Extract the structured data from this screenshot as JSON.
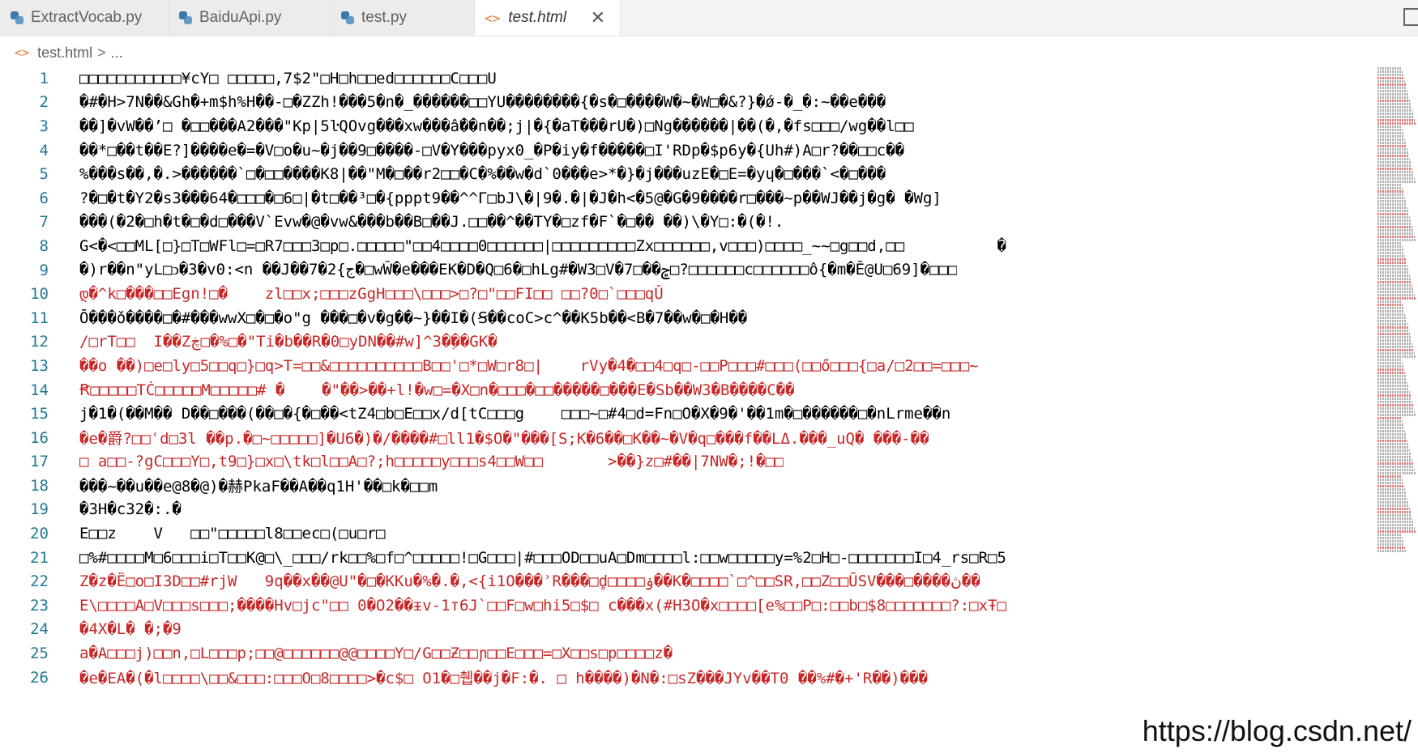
{
  "tabs": [
    {
      "label": "ExtractVocab.py",
      "icon": "python-file-icon"
    },
    {
      "label": "BaiduApi.py",
      "icon": "python-file-icon"
    },
    {
      "label": "test.py",
      "icon": "python-file-icon"
    },
    {
      "label": "test.html",
      "icon": "html-file-icon",
      "active": true,
      "close": "✕"
    }
  ],
  "breadcrumb": {
    "file": "test.html",
    "sep": ">",
    "rest": "..."
  },
  "editor": {
    "lines": [
      {
        "n": "1",
        "text": "□□□□□□□□□□□¥cY□ □□□□□,7$2\"□H□h□□ed□□□□□□C□□□U",
        "red": false
      },
      {
        "n": "2",
        "text": "�#�H>7N��&Gh�+m$h%H��-□�ZZh!���5�n�_������□□YU��������{�s�□����W�~�W□�&?}�ǿ-�_�:~��e���",
        "red": false
      },
      {
        "n": "3",
        "text": "��]�vW��’□ �□□���A2���\"Kp|5ŀQOvg���xw���ấ��n��;j|�{�aT���rU�)□Ng������|��(�,�fs□□□/wg��l□□",
        "red": false
      },
      {
        "n": "4",
        "text": "��*□��t��E?]����e�=�V□o�u~�j��9□����-□V�Y���pyx0_�P�iy�f�����□I'RDp�$p6y�{Uh#)A□r?��□□c��",
        "red": false
      },
      {
        "n": "5",
        "text": "%���s��,�.>������`□�□□����K8|��\"M�□��r2□□�C�%��w�d`0���e>*�}�j���uzE�□E=�yɥ�□���`<�□���",
        "red": false
      },
      {
        "n": "6",
        "text": "?�□�t�Y2�s3���64�□□□�□6□|�t□��³□�{pppt9��^^Γ□bJ\\�|9�.�|�J�h<�5@�G�9����r□���~p��WJ��j�g� �Wg]",
        "red": false
      },
      {
        "n": "7",
        "text": "���(�2�□h�t�□�d□���V`Evw�@�vw&���b��B□��J.□□��^��TY�□zf�F`�□�� ��)\\�Y□:�(�!.",
        "red": false
      },
      {
        "n": "8",
        "text": "G<�<□□ML[□}□T□WFl□=□R7□□□3□p□.□□□□□\"□□4□□□□0□□□□□□|□□□□□□□□□Zx□□□□□□,v□□□)□□□□_~~□g□□d,□□          �",
        "red": false
      },
      {
        "n": "9",
        "text": "�)r��n\"yL□ↄ�3�v0:<n ��J��7�2{ج�□wŴ�e���EK�D�Q□6�□hLg#�W3□V�7□��ݮ□?□□□□□□c□□□□□□ô{�m�Ĕ@U□69]�□□□",
        "red": false
      },
      {
        "n": "10",
        "text": "დ�^k□���□□Egn!□�    zl□□x;□□□zGgH□□□\\□□□>□?□\"□□FI□□ □□?0□`□□□qǓ",
        "red": true
      },
      {
        "n": "11",
        "text": "Ō���ǒ����□�#���wwX□�□�o\"g ���□�v�g��~}��I�(Ꞩ��coC>c^��K5b��<B�7��w�□�H��",
        "red": false
      },
      {
        "n": "12",
        "text": "/□rT□□  I��Zڿ□�%□�\"Ti�b��R�0□yDN��#w]^3�ٜ��GK�",
        "red": true
      },
      {
        "n": "13",
        "text": "��o ��)□e□ly□5□□q□}□q>T=□□&□□□□□□□□□□B□□'□*□W□r8□|    rVy�4�□□4□q□-□□P□□□#□□□(□□ő□□□{□a/□2□□=□□□~",
        "red": true
      },
      {
        "n": "14",
        "text": "Ꞧ□□□□□TĊ□□□□□M□□□□□# �    �\"��>��+l!�w□=�X□n�□□□�□□�����□���E�Sb��W3�B����C��",
        "red": true
      },
      {
        "n": "15",
        "text": "j�1�(��M�� D��□���(��□�{�□��<tZ4□b□E□□x/d[tC□□□g    □□□~□#4□d=Fn□O�X�9�'��1m�□������□�nLrme��n",
        "red": false
      },
      {
        "n": "16",
        "text": "�e�爵?□□ʿd□3l ��p.�□~□□□□□]�U6�)�/����#□ll1�$O�\"���[S;K�6��□K��~�V�q□���f��LΔ.���_uQ� ���-��",
        "red": true
      },
      {
        "n": "17",
        "text": "□ a□□-?gC□□□Y□,t9□}□x□\\tk□l□□A□?;h□□□□□y□□□s4□□W□□       >��}z□#��|7NW�;!�□□",
        "red": true
      },
      {
        "n": "18",
        "text": "���~��u��e@8�@)�赫PkaF��A��q1H'��□k�□□m",
        "red": false
      },
      {
        "n": "19",
        "text": "�3H�c32�:.�",
        "red": false
      },
      {
        "n": "20",
        "text": "E□□z    V   □□\"□□□□□l8□□ec□(□u□r□",
        "red": false
      },
      {
        "n": "21",
        "text": "□%#□□□□M□6□□□i□T□□K@□\\_□□□/rk□□%□f□^□□□□□!□G□□□|#□□□OD□□uA□Dm□□□□l:□□w□□□□□y=%2□H□-□□□□□□□I□4_rs□R□5",
        "red": false
      },
      {
        "n": "22",
        "text": "Z�z�Ë□o□I3D□□#rjW   9q��x��@U\"�□�KKu�%�.�,<{i1O���ʾR���□d̥□□□□ۏ��K�□□□□`□^□□SR,□□Z□□ŪSV���□����ڽ��",
        "red": true
      },
      {
        "n": "23",
        "text": "E\\□□□□A□V□□□s□□□;����Hv□jc\"□□ 0�O2��ᵻv-1т6J`□□F□w□hi5□$□ c���x(#H3O�x□□□□[e%□□P□:□□b□$8□□□□□□□?:□xŦ□",
        "red": true
      },
      {
        "n": "24",
        "text": "�4X�L� �;�9",
        "red": true
      },
      {
        "n": "25",
        "text": "a�A□□□j)□□n,□L□□□p;□□@□□□□□□@@□□□□Y□/G□□Ƶ□□ɲ□□E□□□=□X□□s□p□□□□z�",
        "red": true
      },
      {
        "n": "26",
        "text": "�e�EA�(�l□□□□\\□□&□□□:□□□O□8□□□□>�c$□ O1�□췝��j�F:�. □ h����)�N�:□sZ���JYv��T0 ��%#�+'R��)���",
        "red": true
      }
    ]
  },
  "watermark": "https://blog.csdn.net/"
}
